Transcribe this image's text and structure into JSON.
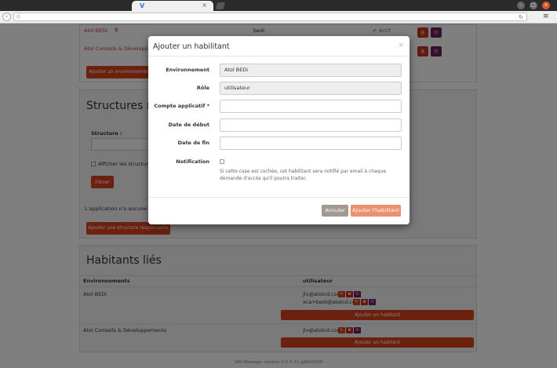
{
  "browser": {
    "tab_favicon": "V",
    "tab_close": "×",
    "url": "",
    "menu_icon": "≡"
  },
  "top_table": {
    "rows": [
      {
        "environment": "Atol BEDi",
        "user": "bedi",
        "status": "Actif"
      },
      {
        "environment": "Atol Conseils & Développements",
        "user": "",
        "status": ""
      }
    ],
    "add_env_button": "Ajouter un environnement"
  },
  "structures": {
    "title": "Structures re",
    "structure_label": "Structure :",
    "show_checkbox_label": "Afficher les structures",
    "filter_button": "Filtrer",
    "empty_text": "L'application n'a aucune stru",
    "add_structure_button": "Ajouter une structure responsable"
  },
  "habitants": {
    "title": "Habitants liés",
    "col_env": "Environnements",
    "col_role": "utilisateur",
    "rows": [
      {
        "environment": "Atol BEDi",
        "users": [
          "jlv@atolcd.com",
          "xca+bedi@atolcd.com"
        ],
        "add_button": "Ajouter un habitant"
      },
      {
        "environment": "Atol Conseils & Développements",
        "users": [
          "jlv@atolcd.com"
        ],
        "add_button": "Ajouter un habitant"
      }
    ]
  },
  "footer": {
    "version": "IAM Manager version 0.2.5-11-g8b01839"
  },
  "modal": {
    "title": "Ajouter un habilitant",
    "close": "×",
    "env_label": "Environnement",
    "env_value": "Atol BEDi",
    "role_label": "Rôle",
    "role_value": "utilisateur",
    "account_label": "Compte applicatif *",
    "start_label": "Date de début",
    "end_label": "Date de fin",
    "notif_label": "Notification",
    "notif_help": "Si cette case est cochée, cet habilitant sera notifié par email à chaque demande d'accès qu'il pourra traiter.",
    "cancel_button": "Annuler",
    "submit_button": "Ajouter l'habilitant"
  },
  "colors": {
    "accent": "#d9431e",
    "status_green": "#4a9a3a",
    "lock_red": "#c9302c",
    "power_purple": "#6d1f5e",
    "cancel_gray": "#a09a92",
    "submit_orange": "#e9906f"
  }
}
